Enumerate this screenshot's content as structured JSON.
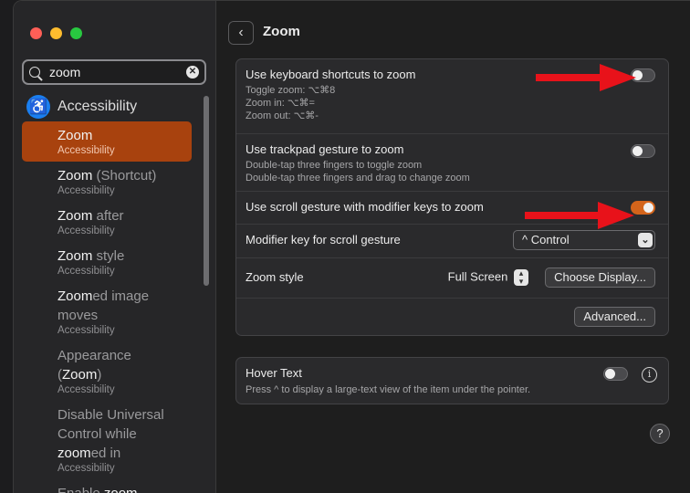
{
  "sidebar": {
    "search": {
      "value": "zoom",
      "clear_icon": "✕"
    },
    "section": {
      "icon": "accessibility-icon",
      "label": "Accessibility"
    },
    "items": [
      {
        "t1": "Zoom",
        "t2": "",
        "sub": "Accessibility",
        "selected": true
      },
      {
        "t1": "Zoom",
        "t2": " (Shortcut)",
        "sub": "Accessibility"
      },
      {
        "t1": "Zoom",
        "t2": " after",
        "sub": "Accessibility"
      },
      {
        "t1": "Zoom",
        "t2": " style",
        "sub": "Accessibility"
      },
      {
        "t1": "Zoom",
        "t2": "ed image moves",
        "sub": "Accessibility"
      },
      {
        "t0": "Appearance (",
        "t1": "Zoom",
        "t2": ")",
        "sub": "Accessibility"
      },
      {
        "t0": "Disable Universal Control while ",
        "t1": "zoom",
        "t2": "ed in",
        "sub": "Accessibility"
      },
      {
        "t0": "Enable ",
        "t1": "zoom",
        "t2": "",
        "sub": ""
      }
    ]
  },
  "main": {
    "back_icon": "‹",
    "title": "Zoom",
    "keyboard": {
      "label": "Use keyboard shortcuts to zoom",
      "sub1": "Toggle zoom: ⌥⌘8",
      "sub2": "Zoom in: ⌥⌘=",
      "sub3": "Zoom out: ⌥⌘-",
      "enabled": false
    },
    "trackpad": {
      "label": "Use trackpad gesture to zoom",
      "sub1": "Double-tap three fingers to toggle zoom",
      "sub2": "Double-tap three fingers and drag to change zoom",
      "enabled": false
    },
    "scroll": {
      "label": "Use scroll gesture with modifier keys to zoom",
      "enabled": true
    },
    "modifier": {
      "label": "Modifier key for scroll gesture",
      "value": "^ Control"
    },
    "style": {
      "label": "Zoom style",
      "value": "Full Screen",
      "choose_display": "Choose Display..."
    },
    "advanced_label": "Advanced...",
    "hover": {
      "label": "Hover Text",
      "sub": "Press ^ to display a large-text view of the item under the pointer.",
      "enabled": false
    },
    "help_label": "?"
  },
  "colors": {
    "accent": "#d3641b",
    "selection": "#a8420e",
    "arrow": "#e8121a"
  }
}
